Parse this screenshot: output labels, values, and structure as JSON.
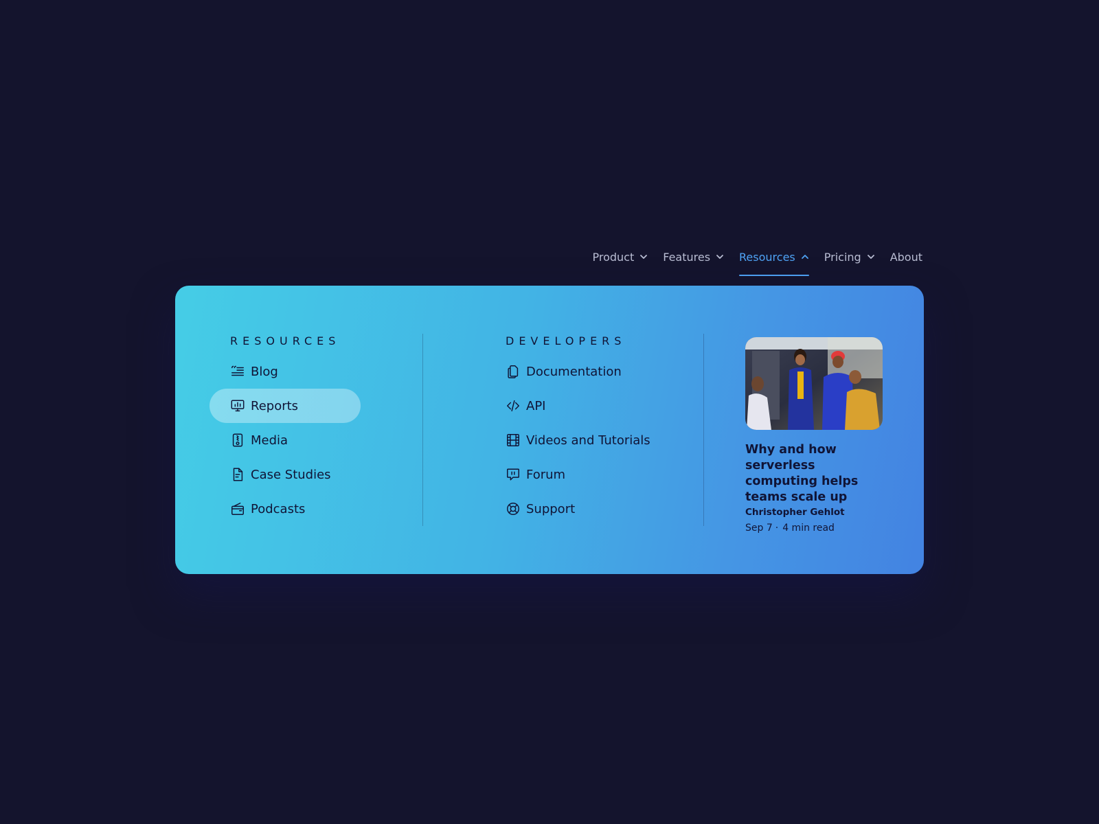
{
  "nav": {
    "items": [
      {
        "label": "Product"
      },
      {
        "label": "Features"
      },
      {
        "label": "Resources"
      },
      {
        "label": "Pricing"
      },
      {
        "label": "About"
      }
    ]
  },
  "resources": {
    "heading": "RESOURCES",
    "items": [
      {
        "label": "Blog",
        "icon": "blog-icon"
      },
      {
        "label": "Reports",
        "icon": "monitor-chart-icon"
      },
      {
        "label": "Media",
        "icon": "media-file-icon"
      },
      {
        "label": "Case Studies",
        "icon": "document-icon"
      },
      {
        "label": "Podcasts",
        "icon": "radio-icon"
      }
    ]
  },
  "developers": {
    "heading": "DEVELOPERS",
    "items": [
      {
        "label": "Documentation",
        "icon": "copy-docs-icon"
      },
      {
        "label": "API",
        "icon": "code-icon"
      },
      {
        "label": "Videos and Tutorials",
        "icon": "film-icon"
      },
      {
        "label": "Forum",
        "icon": "chat-bubble-icon"
      },
      {
        "label": "Support",
        "icon": "lifebuoy-icon"
      }
    ]
  },
  "featured": {
    "title": "Why and how serverless computing helps teams scale up",
    "author": "Christopher Gehlot",
    "date": "Sep 7",
    "separator": "·",
    "read_time": "4 min read"
  },
  "colors": {
    "background": "#14142d",
    "accent": "#4fa3f5",
    "panel_start": "#45cde6",
    "panel_end": "#4383e2",
    "text_dark": "#101436"
  }
}
